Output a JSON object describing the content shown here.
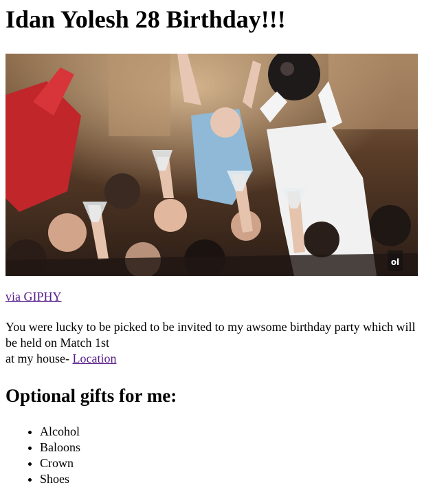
{
  "header": {
    "title": "Idan Yolesh 28 Birthday!!!"
  },
  "gif": {
    "alt": "party celebration gif",
    "watermark": "ol"
  },
  "via": {
    "link_text": "via GIPHY"
  },
  "invite": {
    "line1": "You were lucky to be picked to be invited to my awsome birthday party which will be held on Match 1st",
    "line2_prefix": "at my house- ",
    "location_link": "Location"
  },
  "gifts": {
    "title": "Optional gifts for me:",
    "items": [
      "Alcohol",
      "Baloons",
      "Crown",
      "Shoes"
    ]
  },
  "colors": {
    "visited_link": "#551a8b",
    "text": "#000000",
    "background": "#ffffff"
  }
}
